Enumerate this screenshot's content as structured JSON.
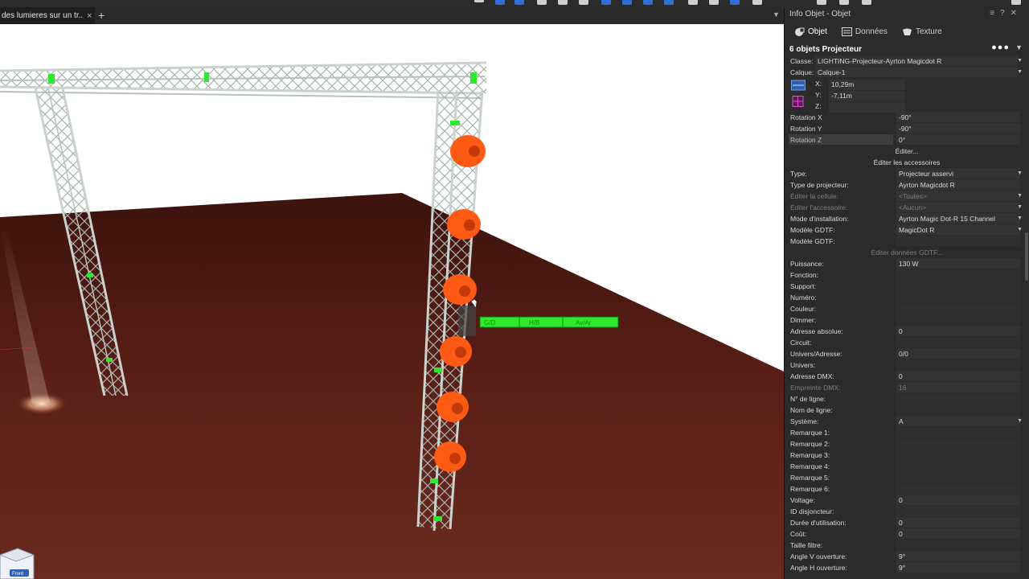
{
  "document": {
    "tab_title": "des lumieres sur un tr...",
    "close_glyph": "×",
    "add_glyph": "+"
  },
  "panel": {
    "title": "Info Objet - Objet",
    "tabs": [
      {
        "label": "Objet",
        "icon": "object-icon"
      },
      {
        "label": "Données",
        "icon": "data-icon"
      },
      {
        "label": "Texture",
        "icon": "texture-icon"
      }
    ],
    "selection_title": "6 objets Projecteur",
    "classe": {
      "label": "Classe:",
      "value": "LIGHTING-Projecteur-Ayrton Magicdot R"
    },
    "calque": {
      "label": "Calque:",
      "value": "Calque-1"
    },
    "x": {
      "label": "X:",
      "value": "10,29m"
    },
    "y": {
      "label": "Y:",
      "value": "-7,11m"
    },
    "z": {
      "label": "Z:",
      "value": ""
    },
    "rotation": [
      {
        "label": "Rotation X",
        "value": "-90°"
      },
      {
        "label": "Rotation Y",
        "value": "-90°"
      },
      {
        "label": "Rotation Z",
        "value": "0°"
      }
    ],
    "edit_label": "Éditer...",
    "edit_accessories_label": "Éditer les accessoires",
    "props_a": [
      {
        "label": "Type:",
        "value": "Projecteur asservi",
        "dropdown": true,
        "dim": false
      },
      {
        "label": "Type de projecteur:",
        "value": "Ayrton Magicdot R",
        "dropdown": false,
        "dim": false
      },
      {
        "label": "Éditer la cellule:",
        "value": "<Toutes>",
        "dropdown": true,
        "dim": true
      },
      {
        "label": "Éditer l'accessoire:",
        "value": "<Aucun>",
        "dropdown": true,
        "dim": true
      },
      {
        "label": "Mode d'installation:",
        "value": "Ayrton Magic Dot-R 15 Channel",
        "dropdown": true,
        "dim": false
      },
      {
        "label": "Modèle GDTF:",
        "value": "MagicDot R",
        "dropdown": true,
        "dim": false
      },
      {
        "label": "Modèle GDTF:",
        "value": "",
        "dropdown": false,
        "dim": false
      }
    ],
    "edit_gdtf_label": "Éditer données GDTF...",
    "props_b": [
      {
        "label": "Puissance:",
        "value": "130 W",
        "dim": false
      },
      {
        "label": "Fonction:",
        "value": "",
        "dim": false
      },
      {
        "label": "Support:",
        "value": "",
        "dim": false
      },
      {
        "label": "Numéro:",
        "value": "",
        "dim": false
      },
      {
        "label": "Couleur:",
        "value": "",
        "dim": false
      },
      {
        "label": "Dimmer:",
        "value": "",
        "dim": false
      },
      {
        "label": "Adresse absolue:",
        "value": "0",
        "dim": false
      },
      {
        "label": "Circuit:",
        "value": "",
        "dim": false
      },
      {
        "label": "Univers/Adresse:",
        "value": "0/0",
        "dim": false
      },
      {
        "label": "Univers:",
        "value": "",
        "dim": false
      },
      {
        "label": "Adresse DMX:",
        "value": "0",
        "dim": false
      },
      {
        "label": "Empreinte DMX:",
        "value": "16",
        "dim": true
      },
      {
        "label": "N° de ligne:",
        "value": "",
        "dim": false
      },
      {
        "label": "Nom de ligne:",
        "value": "",
        "dim": false
      },
      {
        "label": "Système:",
        "value": "A",
        "dim": false,
        "dropdown": true
      },
      {
        "label": "Remarque 1:",
        "value": "",
        "dim": false
      },
      {
        "label": "Remarque 2:",
        "value": "",
        "dim": false
      },
      {
        "label": "Remarque 3:",
        "value": "",
        "dim": false
      },
      {
        "label": "Remarque 4:",
        "value": "",
        "dim": false
      },
      {
        "label": "Remarque 5:",
        "value": "",
        "dim": false
      },
      {
        "label": "Remarque 6:",
        "value": "",
        "dim": false
      },
      {
        "label": "Voltage:",
        "value": "0",
        "dim": false
      },
      {
        "label": "ID disjoncteur:",
        "value": "",
        "dim": false
      },
      {
        "label": "Durée d'utilisation:",
        "value": "0",
        "dim": false
      },
      {
        "label": "Coût:",
        "value": "0",
        "dim": false
      },
      {
        "label": "Taille filtre:",
        "value": "",
        "dim": false
      },
      {
        "label": "Angle V ouverture:",
        "value": "9°",
        "dim": false
      },
      {
        "label": "Angle H ouverture:",
        "value": "9°",
        "dim": false
      }
    ]
  },
  "viewport": {
    "gizmo_labels": [
      "G/D",
      "H/B",
      "Av/Ar"
    ],
    "view_cube_label": "Front"
  },
  "colors": {
    "accent_green": "#2eea2e",
    "fixture_orange": "#ff5a14",
    "floor_wood": "#4e1a12"
  }
}
